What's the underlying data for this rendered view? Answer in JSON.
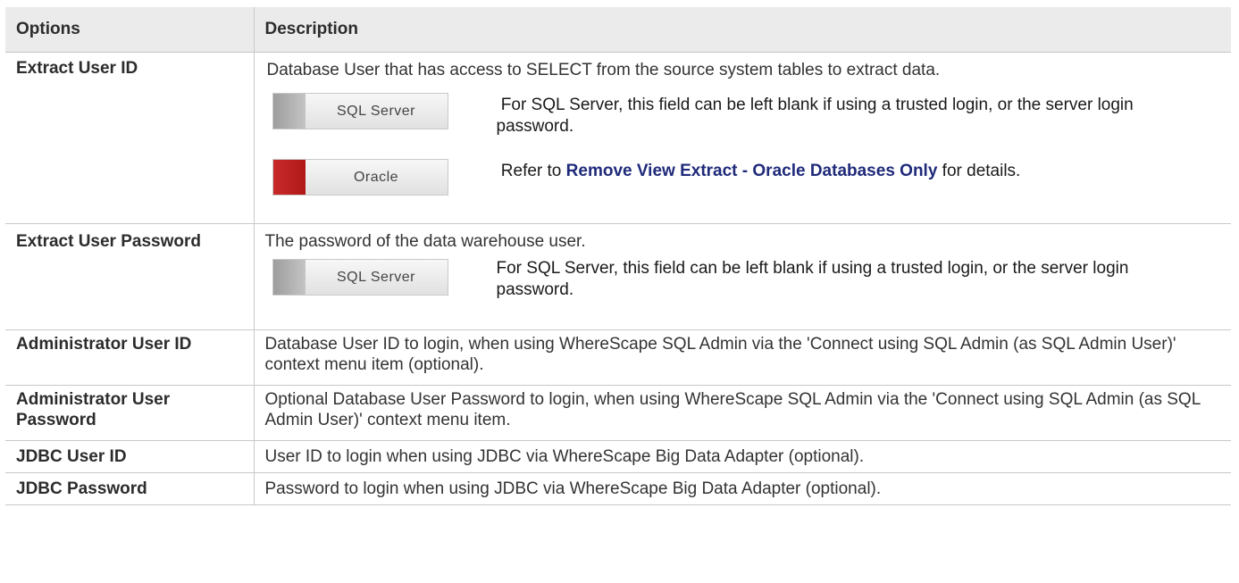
{
  "table": {
    "headers": [
      "Options",
      "Description"
    ],
    "rows": [
      {
        "option": "Extract User ID",
        "description": "Database User that has access to SELECT from the source system tables to extract data.",
        "notes": [
          {
            "badge": "SQL Server",
            "badge_color": "#a8a8a8",
            "text": " For SQL Server, this field can be left blank if using a trusted login, or the server login password."
          },
          {
            "badge": "Oracle",
            "badge_color": "#c0201f",
            "text_prefix": " Refer to ",
            "link_text": "Remove View Extract - Oracle Databases Only",
            "text_suffix": " for details."
          }
        ]
      },
      {
        "option": "Extract User Password",
        "description": "The password of the data warehouse user.",
        "notes": [
          {
            "badge": "SQL Server",
            "badge_color": "#a8a8a8",
            "text": "For SQL Server, this field can be left blank if using a trusted login, or the server login password."
          }
        ]
      },
      {
        "option": "Administrator User ID",
        "description": "Database User ID to login, when using WhereScape SQL Admin via the 'Connect using SQL Admin (as SQL Admin User)' context menu item (optional)."
      },
      {
        "option": "Administrator User Password",
        "description": "Optional Database User Password to login, when using WhereScape SQL Admin via the 'Connect using SQL Admin (as SQL Admin User)' context menu item."
      },
      {
        "option": "JDBC User ID",
        "description": "User ID to login when using JDBC via WhereScape Big Data Adapter (optional)."
      },
      {
        "option": "JDBC Password",
        "description": "Password to login when using JDBC via WhereScape Big Data Adapter (optional)."
      }
    ]
  },
  "colors": {
    "header_bg": "#ebebeb",
    "border": "#c8c8c8",
    "link": "#1f2a7a"
  }
}
